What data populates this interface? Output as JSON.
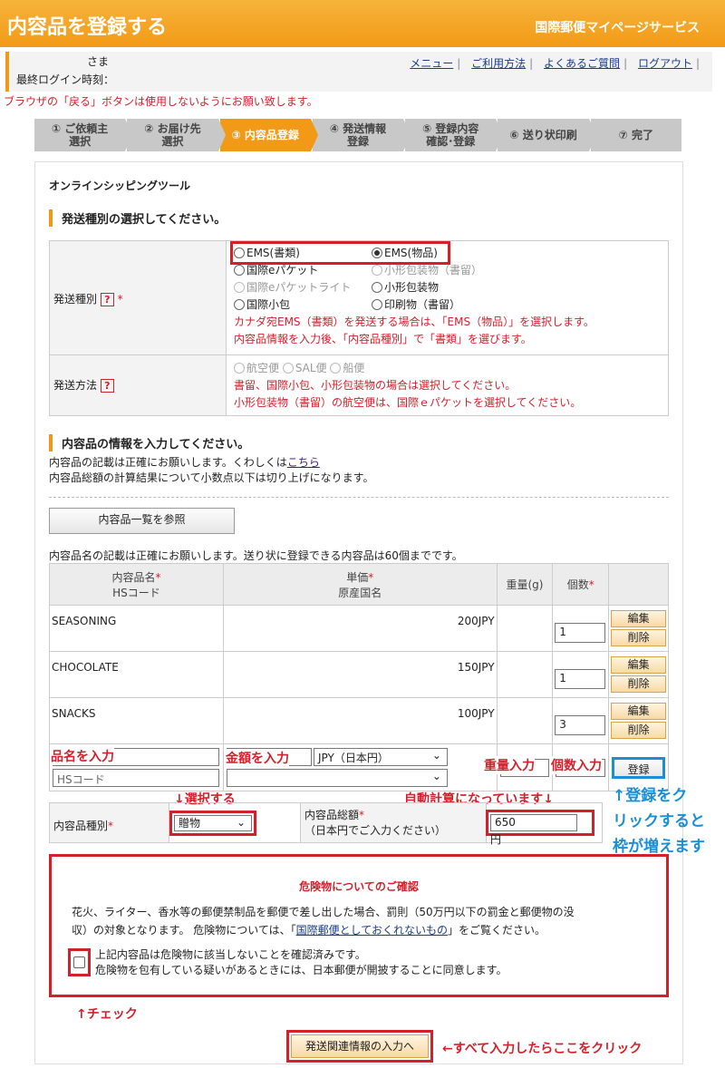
{
  "header": {
    "title": "内容品を登録する",
    "service": "国際郵便マイページサービス"
  },
  "user": {
    "sama": "さま",
    "last_login": "最終ログイン時刻："
  },
  "toplinks": [
    "メニュー",
    "ご利用方法",
    "よくあるご質問",
    "ログアウト"
  ],
  "warning": "ブラウザの「戻る」ボタンは使用しないようにお願い致します。",
  "steps": [
    {
      "line1": "① ご依頼主",
      "line2": "選択"
    },
    {
      "line1": "② お届け先",
      "line2": "選択"
    },
    {
      "line1": "③ 内容品登録",
      "line2": ""
    },
    {
      "line1": "④ 発送情報",
      "line2": "登録"
    },
    {
      "line1": "⑤ 登録内容",
      "line2": "確認･登録"
    },
    {
      "line1": "⑥ 送り状印刷",
      "line2": ""
    },
    {
      "line1": "⑦ 完了",
      "line2": ""
    }
  ],
  "shiptool": "オンラインシッピングツール",
  "section1": {
    "title": "発送種別の選択してください。",
    "type_label": "発送種別",
    "method_label": "発送方法",
    "help": "?",
    "req": "*",
    "opts": [
      "EMS(書類)",
      "EMS(物品)",
      "国際eパケット",
      "小形包装物（書留）",
      "国際eパケットライト",
      "小形包装物",
      "国際小包",
      "印刷物（書留）"
    ],
    "note1": "カナダ宛EMS（書類）を発送する場合は、「EMS（物品）」を選択します。",
    "note2": "内容品情報を入力後、「内容品種別」で「書類」を選びます。",
    "methods": [
      "航空便",
      "SAL便",
      "船便"
    ],
    "mnote1": "書留、国際小包、小形包装物の場合は選択してください。",
    "mnote2": "小形包装物（書留）の航空便は、国際ｅパケットを選択してください。"
  },
  "section2": {
    "title": "内容品の情報を入力してください。",
    "desc1_pre": "内容品の記載は正確にお願いします。くわしくは",
    "desc1_link": "こちら",
    "desc2": "内容品総額の計算結果について小数点以下は切り上げになります。",
    "browse_button": "内容品一覧を参照",
    "limit": "内容品名の記載は正確にお願いします。送り状に登録できる内容品は60個までです。"
  },
  "table": {
    "h_name": "内容品名",
    "h_hs": "HSコード",
    "h_price": "単価",
    "h_origin": "原産国名",
    "h_weight": "重量(g)",
    "h_qty": "個数",
    "rows": [
      {
        "name": "SEASONING",
        "price": "200JPY",
        "qty": "1"
      },
      {
        "name": "CHOCOLATE",
        "price": "150JPY",
        "qty": "1"
      },
      {
        "name": "SNACKS",
        "price": "100JPY",
        "qty": "3"
      }
    ],
    "edit": "編集",
    "delete": "削除",
    "hs_placeholder": "HSコード",
    "currency": "JPY（日本円）",
    "register": "登録"
  },
  "kind": {
    "label": "内容品種別",
    "value": "贈物",
    "total_label": "内容品総額",
    "total_sub": "（日本円でご入力ください）",
    "total_value": "650",
    "yen": "円"
  },
  "danger": {
    "title": "危険物についてのご確認",
    "text1": "花火、ライター、香水等の郵便禁制品を郵便で差し出した場合、罰則（50万円以下の罰金と郵便物の没",
    "text2_pre": "収）の対象となります。 危険物については、「",
    "text2_link": "国際郵便としておくれないもの",
    "text2_post": "」をご覧ください。",
    "check1": "上記内容品は危険物に該当しないことを確認済みです。",
    "check2": "危険物を包有している疑いがあるときには、日本郵便が開披することに同意します。"
  },
  "submit": "発送関連情報の入力へ",
  "annotations": {
    "name": "品名を入力",
    "price": "金額を入力",
    "weight": "重量入力",
    "qty": "個数入力",
    "select": "↓選択する",
    "auto": "自動計算になっています↓",
    "blue1": "↑登録をク",
    "blue2": "リックすると",
    "blue3": "枠が増えます",
    "check": "↑チェック",
    "submit": "←すべて入力したらここをクリック"
  }
}
